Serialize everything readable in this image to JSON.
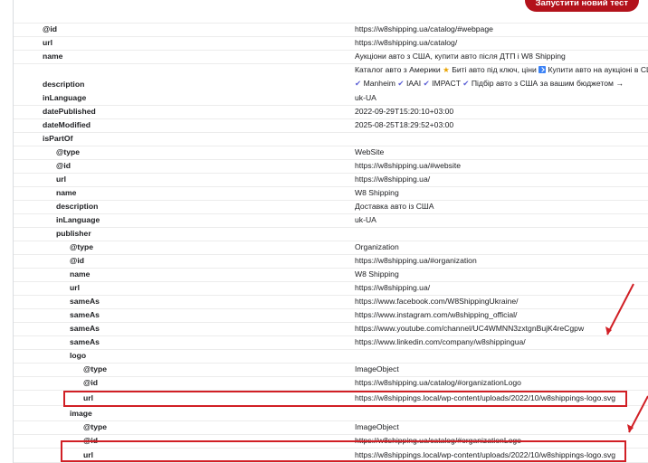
{
  "toolbar": {
    "run_test_label": "Запустити новий тест"
  },
  "rows": [
    {
      "key": "@id",
      "value": "https://w8shipping.ua/catalog/#webpage"
    },
    {
      "key": "url",
      "value": "https://w8shipping.ua/catalog/"
    },
    {
      "key": "name",
      "value": "Аукціони авто з США, купити авто після ДТП і W8 Shipping"
    },
    {
      "key": "description",
      "value_line1": "Каталог авто з Америки",
      "value_line1b": "Биті авто під ключ, ціни",
      "value_line1c": "Купити авто на аукціоні в США -",
      "value_line2a": "Manheim",
      "value_line2b": "IAAI",
      "value_line2c": "IMPACT",
      "value_line2d": "Підбір авто з США за вашим бюджетом →"
    },
    {
      "key": "inLanguage",
      "value": "uk-UA"
    },
    {
      "key": "datePublished",
      "value": "2022-09-29T15:20:10+03:00"
    },
    {
      "key": "dateModified",
      "value": "2025-08-25T18:29:52+03:00"
    },
    {
      "key": "isPartOf",
      "value": ""
    },
    {
      "key": "@type",
      "value": "WebSite"
    },
    {
      "key": "@id",
      "value": "https://w8shipping.ua/#website"
    },
    {
      "key": "url",
      "value": "https://w8shipping.ua/"
    },
    {
      "key": "name",
      "value": "W8 Shipping"
    },
    {
      "key": "description",
      "value": "Доставка авто із США"
    },
    {
      "key": "inLanguage",
      "value": "uk-UA"
    },
    {
      "key": "publisher",
      "value": ""
    },
    {
      "key": "@type",
      "value": "Organization"
    },
    {
      "key": "@id",
      "value": "https://w8shipping.ua/#organization"
    },
    {
      "key": "name",
      "value": "W8 Shipping"
    },
    {
      "key": "url",
      "value": "https://w8shipping.ua/"
    },
    {
      "key": "sameAs",
      "value": "https://www.facebook.com/W8ShippingUkraine/"
    },
    {
      "key": "sameAs",
      "value": "https://www.instagram.com/w8shipping_official/"
    },
    {
      "key": "sameAs",
      "value": "https://www.youtube.com/channel/UC4WMNN3zxtgnBujK4reCgpw"
    },
    {
      "key": "sameAs",
      "value": "https://www.linkedin.com/company/w8shippingua/"
    },
    {
      "key": "logo",
      "value": ""
    },
    {
      "key": "@type",
      "value": "ImageObject"
    },
    {
      "key": "@id",
      "value": "https://w8shipping.ua/catalog/#organizationLogo"
    },
    {
      "key": "url",
      "value": "https://w8shippings.local/wp-content/uploads/2022/10/w8shippings-logo.svg"
    },
    {
      "key": "image",
      "value": ""
    },
    {
      "key": "@type",
      "value": "ImageObject"
    },
    {
      "key": "@id",
      "value": "https://w8shipping.ua/catalog/#organizationLogo"
    },
    {
      "key": "url",
      "value": "https://w8shippings.local/wp-content/uploads/2022/10/w8shippings-logo.svg"
    }
  ],
  "colors": {
    "accent": "#b3121b",
    "highlight": "#d11f25",
    "check": "#5b5fd6"
  }
}
